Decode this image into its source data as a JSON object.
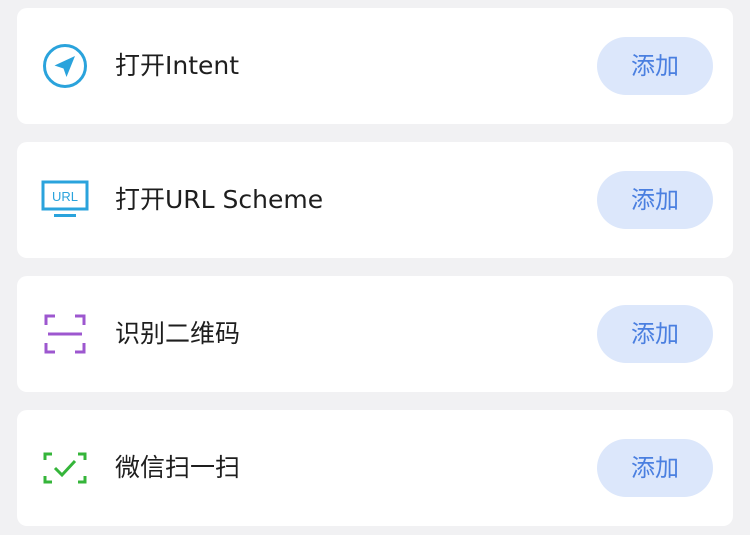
{
  "items": [
    {
      "label": "打开Intent",
      "button": "添加",
      "icon": "paper-plane-icon",
      "color": "#2aa3dc"
    },
    {
      "label": "打开URL Scheme",
      "button": "添加",
      "icon": "url-monitor-icon",
      "color": "#2aa3dc",
      "icon_text": "URL"
    },
    {
      "label": "识别二维码",
      "button": "添加",
      "icon": "scan-frame-icon",
      "color": "#9d57cf"
    },
    {
      "label": "微信扫一扫",
      "button": "添加",
      "icon": "wechat-scan-icon",
      "color": "#35b53a"
    }
  ]
}
